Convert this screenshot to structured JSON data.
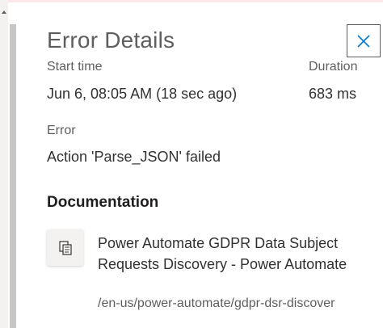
{
  "panel": {
    "title": "Error Details",
    "close_icon": "close-icon",
    "start_time": {
      "label": "Start time",
      "value": "Jun 6, 08:05 AM (18 sec ago)"
    },
    "duration": {
      "label": "Duration",
      "value": "683 ms"
    },
    "error": {
      "label": "Error",
      "value": "Action 'Parse_JSON' failed"
    },
    "documentation": {
      "heading": "Documentation",
      "icon": "copy-document-icon",
      "link_title": "Power Automate GDPR Data Subject Requests Discovery - Power Automate",
      "link_url": "/en-us/power-automate/gdpr-dsr-discover"
    }
  },
  "colors": {
    "accent_border": "#605e5c",
    "scroll_thumb": "#c8c6c4",
    "gutter": "#f3f2f1",
    "top_accent": "#fde7e9"
  }
}
